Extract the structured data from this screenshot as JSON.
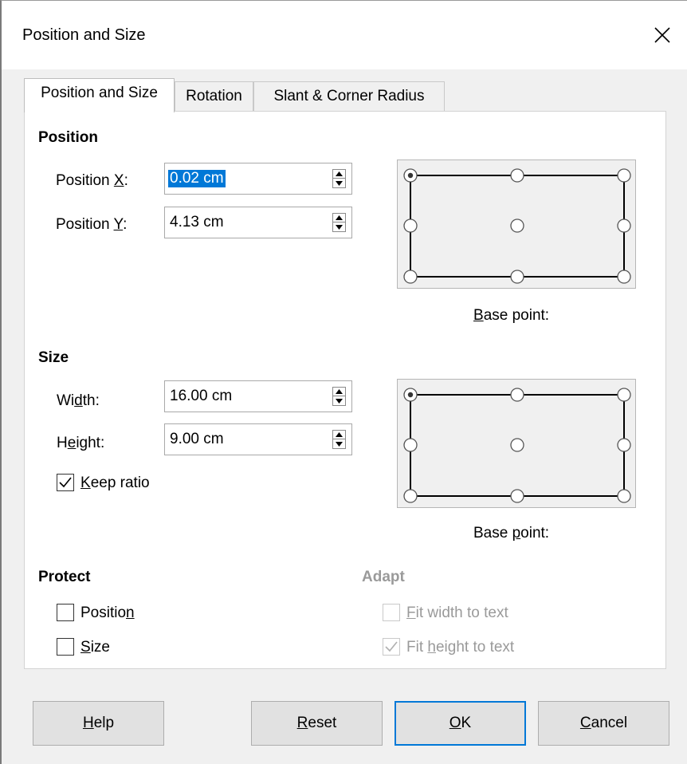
{
  "dialog": {
    "title": "Position and Size",
    "close_icon": "close-icon"
  },
  "tabs": [
    {
      "label": "Position and Size",
      "active": true
    },
    {
      "label": "Rotation",
      "active": false
    },
    {
      "label": "Slant & Corner Radius",
      "active": false
    }
  ],
  "position": {
    "heading": "Position",
    "x_label_pre": "Position ",
    "x_label_key": "X",
    "x_label_post": ":",
    "x_value": "0.02 cm",
    "y_label_pre": "Position ",
    "y_label_key": "Y",
    "y_label_post": ":",
    "y_value": "4.13 cm",
    "base_point_key": "B",
    "base_point_rest": "ase point:",
    "base_point_selected": "top-left"
  },
  "size": {
    "heading": "Size",
    "width_pre": "Wi",
    "width_key": "d",
    "width_post": "th:",
    "width_value": "16.00 cm",
    "height_pre": "H",
    "height_key": "e",
    "height_post": "ight:",
    "height_value": "9.00 cm",
    "keep_ratio_key": "K",
    "keep_ratio_rest": "eep ratio",
    "keep_ratio_checked": true,
    "base_point_pre": "Base ",
    "base_point_key": "p",
    "base_point_post": "oint:",
    "base_point_selected": "top-left"
  },
  "protect": {
    "heading": "Protect",
    "position_pre": "Positio",
    "position_key": "n",
    "position_checked": false,
    "size_key": "S",
    "size_rest": "ize",
    "size_checked": false
  },
  "adapt": {
    "heading": "Adapt",
    "fit_width_key": "F",
    "fit_width_rest": "it width to text",
    "fit_width_checked": false,
    "fit_height_pre": "Fit ",
    "fit_height_key": "h",
    "fit_height_post": "eight to text",
    "fit_height_checked": true
  },
  "buttons": {
    "help_key": "H",
    "help_rest": "elp",
    "reset_key": "R",
    "reset_rest": "eset",
    "ok_key": "O",
    "ok_rest": "K",
    "cancel_key": "C",
    "cancel_rest": "ancel"
  },
  "colors": {
    "selection": "#0078d7",
    "dialog_bg": "#f0f0f0",
    "panel_bg": "#ffffff",
    "disabled_text": "#9a9a9a"
  }
}
